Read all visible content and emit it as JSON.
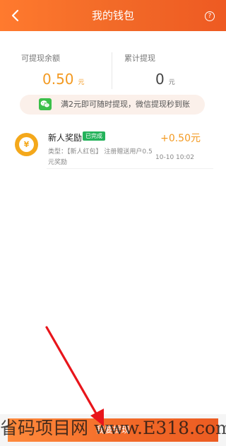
{
  "header": {
    "title": "我的钱包",
    "back_icon": "chevron-left-icon",
    "help_label": "?"
  },
  "balance": {
    "available_label": "可提现余额",
    "available_value": "0.50",
    "available_unit": "元",
    "total_label": "累计提现",
    "total_value": "0",
    "total_unit": "元"
  },
  "notice": {
    "icon": "wechat-icon",
    "text": "满2元即可随时提现，微信提现秒到账"
  },
  "records": [
    {
      "icon": "yuan-coin-icon",
      "coin_symbol": "¥",
      "title": "新人奖励",
      "status": "已完成",
      "amount": "+0.50元",
      "desc": "类型：【新人红包】 注册赠送用户0.5元奖励",
      "time": "10-10 10:02"
    }
  ],
  "footer": {
    "withdraw_label": "我要提现"
  },
  "watermark": "省码项目网 www.E318.com",
  "colors": {
    "brand": "#f26a28",
    "amount": "#f39a22",
    "badge": "#23b25a",
    "wechat": "#3bbf4a"
  }
}
